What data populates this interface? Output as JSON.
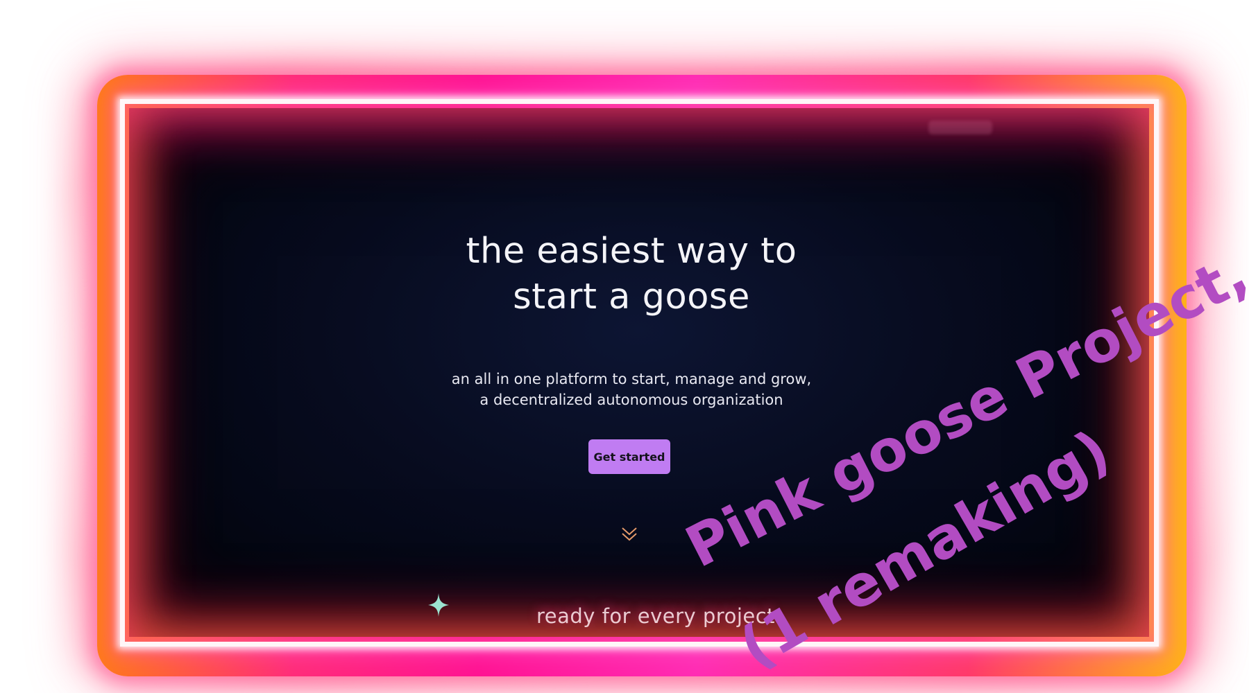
{
  "hero": {
    "title_line1": "the easiest way to",
    "title_line2": "start a goose",
    "subtitle_line1": "an all in one platform to start, manage and grow,",
    "subtitle_line2": "a decentralized autonomous organization",
    "cta_label": "Get started",
    "scroll_icon": "double-chevron-down-icon"
  },
  "next_section": {
    "heading": "ready for every project",
    "decoration_icon": "sparkle-icon"
  },
  "overlay": {
    "graffiti_line1": "Pink goose Project,",
    "graffiti_line2": "(1 remaking)"
  },
  "colors": {
    "panel_background": "#070b1e",
    "cta_background": "#c07cf2",
    "graffiti": "#b24cc2",
    "neon_pink": "#ff1493",
    "neon_orange": "#ff7a1a",
    "sparkle": "#9be3d0",
    "chevron": "#e59a6a"
  }
}
